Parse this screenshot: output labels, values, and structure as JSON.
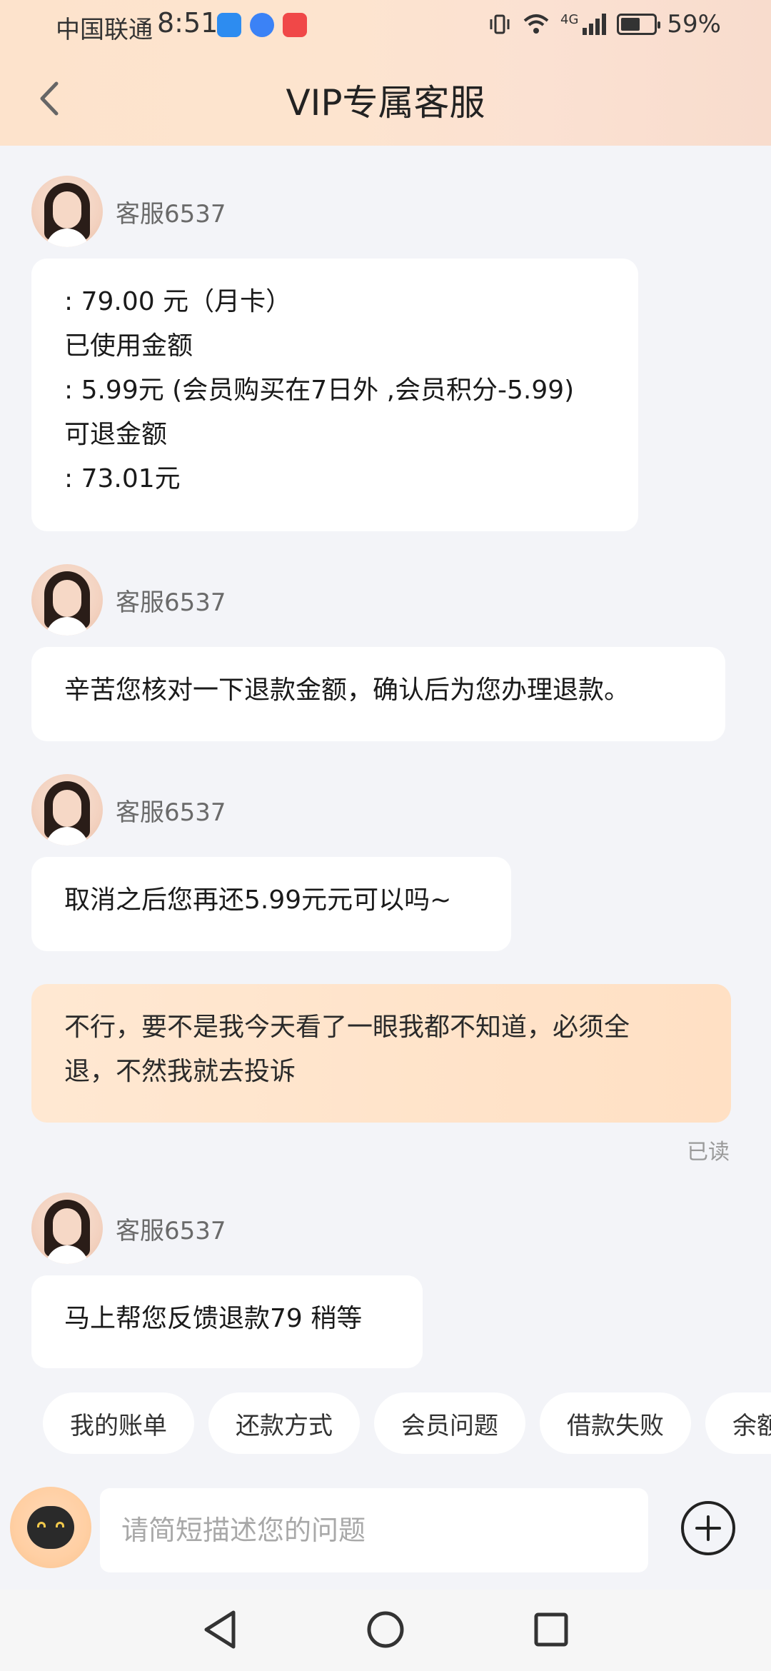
{
  "status_bar": {
    "carrier": "中国联通",
    "time": "8:51",
    "network": "4G",
    "battery_percent": "59%",
    "battery_level": 0.59
  },
  "header": {
    "title": "VIP专属客服"
  },
  "messages": [
    {
      "sender": "agent",
      "name": "客服6537",
      "lines": [
        ": 79.00 元（月卡）",
        "已使用金额",
        ": 5.99元 (会员购买在7日外 ,会员积分-5.99)",
        "可退金额",
        ": 73.01元"
      ]
    },
    {
      "sender": "agent",
      "name": "客服6537",
      "lines": [
        "辛苦您核对一下退款金额，确认后为您办理退款。"
      ]
    },
    {
      "sender": "agent",
      "name": "客服6537",
      "lines": [
        "取消之后您再还5.99元元可以吗~"
      ]
    },
    {
      "sender": "me",
      "lines": [
        "不行，要不是我今天看了一眼我都不知道，必须全",
        "退，不然我就去投诉"
      ],
      "status": "已读"
    },
    {
      "sender": "agent",
      "name": "客服6537",
      "lines": [
        "马上帮您反馈退款79 稍等"
      ]
    }
  ],
  "quick_replies": [
    "我的账单",
    "还款方式",
    "会员问题",
    "借款失败",
    "余额"
  ],
  "input": {
    "placeholder": "请简短描述您的问题"
  },
  "colors": {
    "header_gradient_start": "#fde3cc",
    "my_bubble": "#ffe4cc",
    "page_bg": "#f3f4f8"
  }
}
